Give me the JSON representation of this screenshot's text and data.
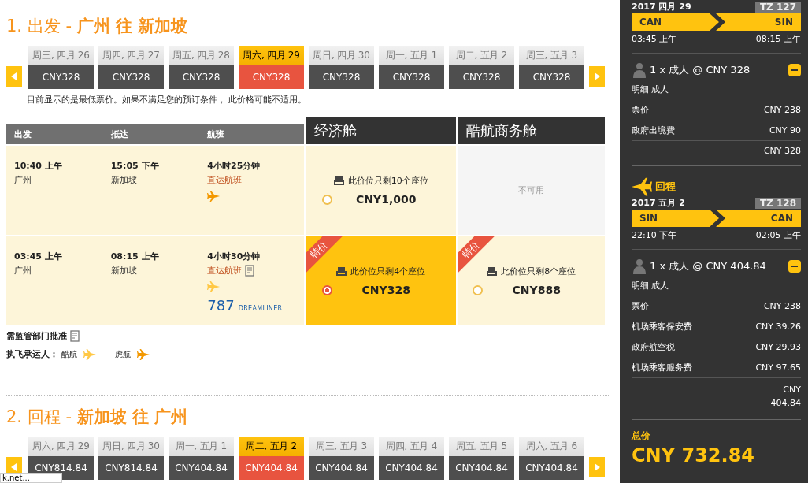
{
  "outbound": {
    "step": "1.",
    "label": "出发",
    "separator": "-",
    "route": "广州 往 新加坡",
    "dates": [
      {
        "day": "周三, 四月 26",
        "price": "CNY328",
        "selected": false
      },
      {
        "day": "周四, 四月 27",
        "price": "CNY328",
        "selected": false
      },
      {
        "day": "周五, 四月 28",
        "price": "CNY328",
        "selected": false
      },
      {
        "day": "周六, 四月 29",
        "price": "CNY328",
        "selected": true
      },
      {
        "day": "周日, 四月 30",
        "price": "CNY328",
        "selected": false
      },
      {
        "day": "周一, 五月 1",
        "price": "CNY328",
        "selected": false
      },
      {
        "day": "周二, 五月 2",
        "price": "CNY328",
        "selected": false
      },
      {
        "day": "周三, 五月 3",
        "price": "CNY328",
        "selected": false
      }
    ],
    "note": "目前显示的是最低票价。如果不满足您的预订条件， 此价格可能不适用。",
    "columns": [
      "出发",
      "抵达",
      "航班"
    ],
    "cabins": [
      "经济舱",
      "酷航商务舱"
    ],
    "flights": [
      {
        "depart_time": "10:40 上午",
        "depart_city": "广州",
        "arrive_time": "15:05 下午",
        "arrive_city": "新加坡",
        "duration": "4小时25分钟",
        "type": "直达航班",
        "approval": false,
        "fares": [
          {
            "kind": "available",
            "seats": "此价位只剩10个座位",
            "price": "CNY1,000",
            "selected": false
          },
          {
            "kind": "unavailable",
            "text": "不可用"
          }
        ]
      },
      {
        "depart_time": "03:45 上午",
        "depart_city": "广州",
        "arrive_time": "08:15 上午",
        "arrive_city": "新加坡",
        "duration": "4小时30分钟",
        "type": "直达航班",
        "approval": true,
        "aircraft": {
          "number": "787",
          "name": "DREAMLINER"
        },
        "fares": [
          {
            "kind": "available",
            "seats": "此价位只剩4个座位",
            "price": "CNY328",
            "badge": "特价",
            "selected": true
          },
          {
            "kind": "available",
            "seats": "此价位只剩8个座位",
            "price": "CNY888",
            "badge": "特价",
            "selected": false
          }
        ]
      }
    ],
    "approval_note": "需监管部门批准",
    "carriers_label": "执飞承运人：",
    "carriers": [
      "酷航",
      "虎航"
    ]
  },
  "return": {
    "step": "2.",
    "label": "回程",
    "separator": "-",
    "route": "新加坡 往 广州",
    "dates": [
      {
        "day": "周六, 四月 29",
        "price": "CNY814.84",
        "selected": false
      },
      {
        "day": "周日, 四月 30",
        "price": "CNY814.84",
        "selected": false
      },
      {
        "day": "周一, 五月 1",
        "price": "CNY404.84",
        "selected": false
      },
      {
        "day": "周二, 五月 2",
        "price": "CNY404.84",
        "selected": true
      },
      {
        "day": "周三, 五月 3",
        "price": "CNY404.84",
        "selected": false
      },
      {
        "day": "周四, 五月 4",
        "price": "CNY404.84",
        "selected": false
      },
      {
        "day": "周五, 五月 5",
        "price": "CNY404.84",
        "selected": false
      },
      {
        "day": "周六, 五月 6",
        "price": "CNY404.84",
        "selected": false
      }
    ]
  },
  "summary": {
    "legs": [
      {
        "date": "2017 四月 29",
        "flight": "TZ 127",
        "from": "CAN",
        "to": "SIN",
        "depart": "03:45 上午",
        "arrive": "08:15 上午",
        "passengers": "1 x 成人 @ CNY 328",
        "breakdown": "明细 成人",
        "fees": [
          {
            "label": "票价",
            "amount": "CNY 238"
          },
          {
            "label": "政府出境費",
            "amount": "CNY 90"
          }
        ],
        "subtotal": "CNY 328"
      },
      {
        "heading": "回程",
        "date": "2017 五月 2",
        "flight": "TZ 128",
        "from": "SIN",
        "to": "CAN",
        "depart": "22:10 下午",
        "arrive": "02:05 上午",
        "passengers": "1 x 成人 @ CNY 404.84",
        "breakdown": "明细 成人",
        "fees": [
          {
            "label": "票价",
            "amount": "CNY 238"
          },
          {
            "label": "机场乘客保安费",
            "amount": "CNY 39.26"
          },
          {
            "label": "政府航空税",
            "amount": "CNY 29.93"
          },
          {
            "label": "机场乘客服务费",
            "amount": "CNY 97.65"
          }
        ],
        "subtotal": "CNY 404.84"
      }
    ],
    "total_label": "总价",
    "total": "CNY 732.84"
  },
  "status_tooltip": "k.net..."
}
